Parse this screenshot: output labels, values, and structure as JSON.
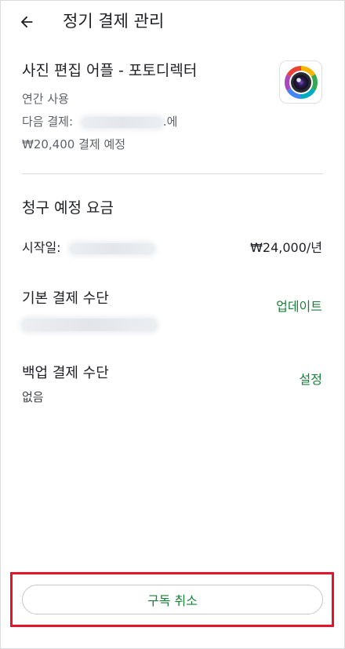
{
  "header": {
    "title": "정기 결제 관리"
  },
  "subscription": {
    "app_name": "사진 편집 어플 - 포토디렉터",
    "plan": "연간 사용",
    "next_payment_prefix": "다음 결제:",
    "next_payment_suffix": ".에",
    "amount_line": "₩20,400 결제 예정"
  },
  "billing": {
    "section_title": "청구 예정 요금",
    "start_label": "시작일:",
    "price": "₩24,000/년"
  },
  "primary_payment": {
    "label": "기본 결제 수단",
    "action": "업데이트"
  },
  "backup_payment": {
    "label": "백업 결제 수단",
    "value": "없음",
    "action": "설정"
  },
  "footer": {
    "cancel_label": "구독 취소"
  },
  "colors": {
    "accent_green": "#188038",
    "highlight_red": "#e5132b"
  }
}
